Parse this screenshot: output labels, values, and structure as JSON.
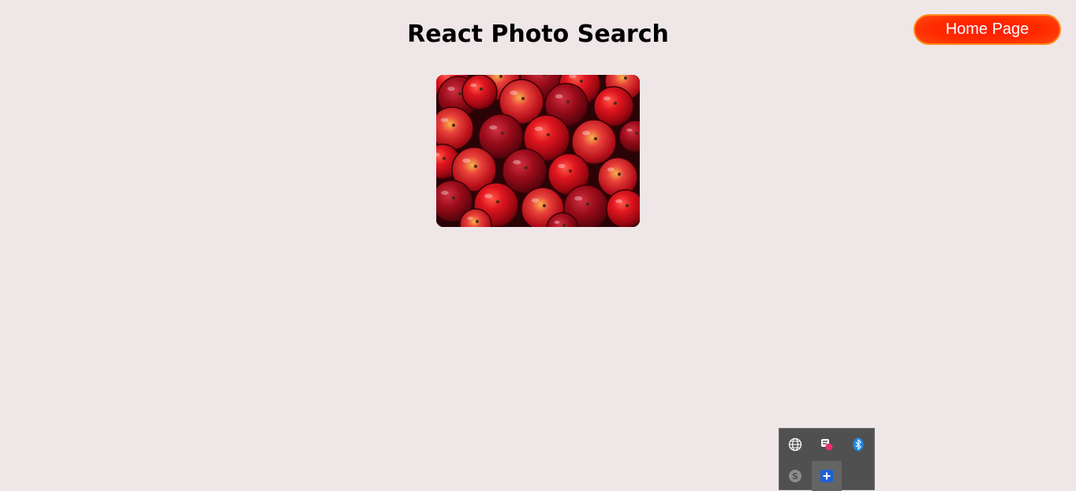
{
  "header": {
    "title": "React Photo Search",
    "home_button_label": "Home Page"
  },
  "photos": [
    {
      "subject": "red apples"
    }
  ],
  "system_tray": {
    "icons": [
      "globe-icon",
      "paint-icon",
      "bluetooth-icon",
      "skype-icon",
      "add-icon"
    ]
  },
  "colors": {
    "page_background": "#efe6e7",
    "button_background": "#ff2a00",
    "button_border": "#ff8a1c",
    "tray_background": "#505050"
  }
}
